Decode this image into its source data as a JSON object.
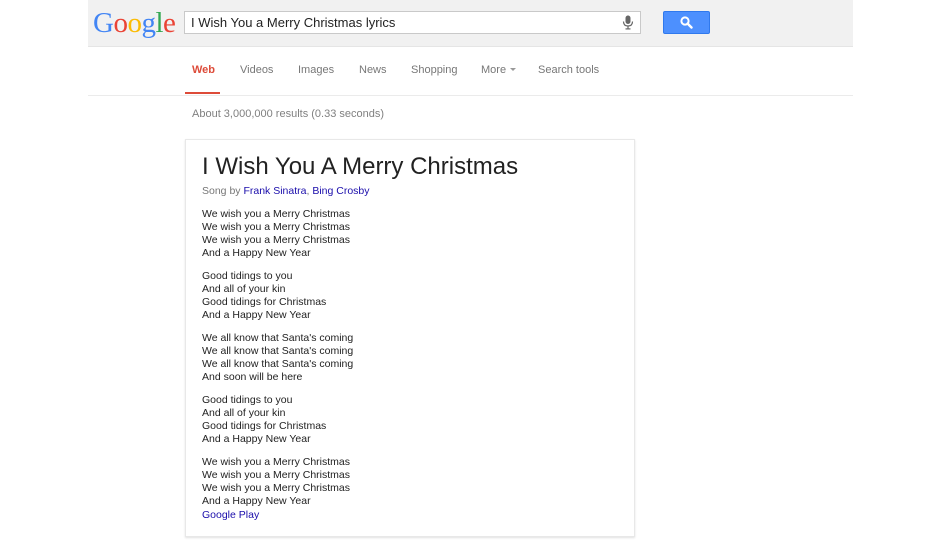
{
  "logo": {
    "text": "Google",
    "letters": [
      {
        "char": "G",
        "color": "#4285f4"
      },
      {
        "char": "o",
        "color": "#ea4335"
      },
      {
        "char": "o",
        "color": "#fbbc05"
      },
      {
        "char": "g",
        "color": "#4285f4"
      },
      {
        "char": "l",
        "color": "#34a853"
      },
      {
        "char": "e",
        "color": "#ea4335"
      }
    ]
  },
  "search": {
    "query": "I Wish You a Merry Christmas lyrics",
    "mic_icon": "microphone-icon",
    "button_icon": "search-icon",
    "button_color": "#4d90fe"
  },
  "tabs": [
    {
      "label": "Web",
      "active": true
    },
    {
      "label": "Videos",
      "active": false
    },
    {
      "label": "Images",
      "active": false
    },
    {
      "label": "News",
      "active": false
    },
    {
      "label": "Shopping",
      "active": false
    },
    {
      "label": "More",
      "active": false,
      "has_caret": true
    },
    {
      "label": "Search tools",
      "active": false
    }
  ],
  "result_stats": "About 3,000,000 results (0.33 seconds)",
  "card": {
    "title": "I Wish You A Merry Christmas",
    "subtitle_prefix": "Song by ",
    "artists": [
      "Frank Sinatra",
      "Bing Crosby"
    ],
    "artist_separator": ", ",
    "stanzas": [
      [
        "We wish you a Merry Christmas",
        "We wish you a Merry Christmas",
        "We wish you a Merry Christmas",
        "And a Happy New Year"
      ],
      [
        "Good tidings to you",
        "And all of your kin",
        "Good tidings for Christmas",
        "And a Happy New Year"
      ],
      [
        "We all know that Santa's coming",
        "We all know that Santa's coming",
        "We all know that Santa's coming",
        "And soon will be here"
      ],
      [
        "Good tidings to you",
        "And all of your kin",
        "Good tidings for Christmas",
        "And a Happy New Year"
      ],
      [
        "We wish you a Merry Christmas",
        "We wish you a Merry Christmas",
        "We wish you a Merry Christmas",
        "And a Happy New Year"
      ]
    ],
    "source": "Google Play"
  },
  "colors": {
    "accent_red": "#dd4b39",
    "link_blue": "#1a0dab"
  }
}
